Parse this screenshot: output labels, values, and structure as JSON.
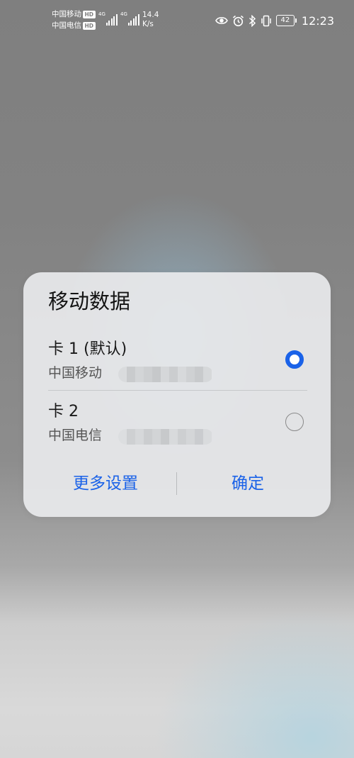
{
  "status_bar": {
    "carrier1": "中国移动",
    "carrier1_badge": "HD",
    "carrier2": "中国电信",
    "carrier2_badge": "HD",
    "network1": "4G",
    "network2": "4G",
    "speed_value": "14.4",
    "speed_unit": "K/s",
    "icons": [
      "eye-icon",
      "alarm-icon",
      "bluetooth-icon",
      "vibrate-icon"
    ],
    "battery_level": "42",
    "time": "12:23"
  },
  "dialog": {
    "title": "移动数据",
    "options": [
      {
        "label": "卡 1 (默认)",
        "carrier": "中国移动",
        "selected": true
      },
      {
        "label": "卡 2",
        "carrier": "中国电信",
        "selected": false
      }
    ],
    "buttons": {
      "more_settings": "更多设置",
      "confirm": "确定"
    }
  },
  "colors": {
    "accent": "#1a62e8",
    "dialog_bg": "#e8eaec"
  }
}
